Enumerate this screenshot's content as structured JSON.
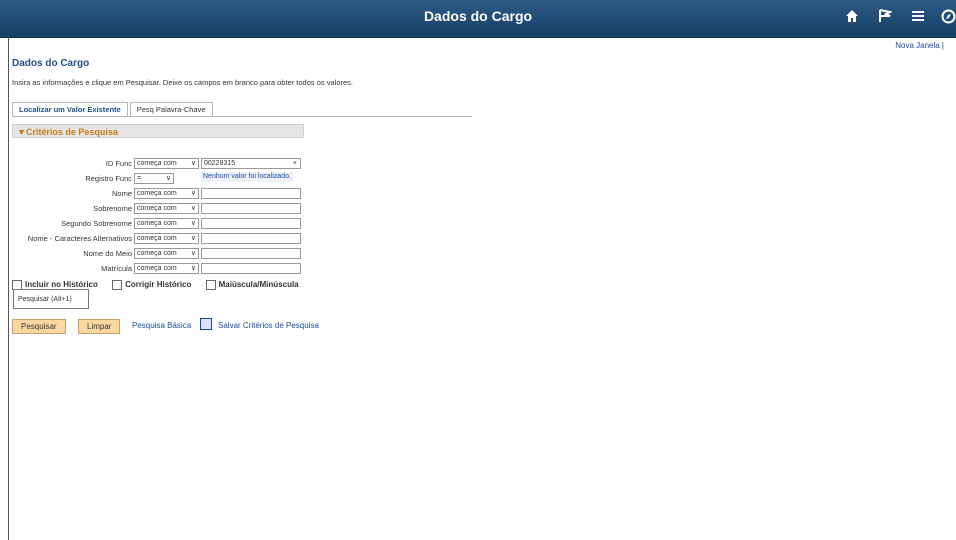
{
  "header": {
    "title": "Dados do Cargo"
  },
  "top_links": {
    "nova_janela": "Nova Janela |"
  },
  "page": {
    "title": "Dados do Cargo",
    "instruction": "Insira as informações e clique em Pesquisar. Deixe os campos em branco para obter todos os valores."
  },
  "tabs": [
    {
      "label": "Localizar um Valor Existente",
      "active": true
    },
    {
      "label": "Pesq Palavra-Chave",
      "active": false
    }
  ],
  "criteria": {
    "title": "▼Critérios de Pesquisa",
    "hint": "Nenhum valor foi localizado.",
    "rows": [
      {
        "label": "ID Func",
        "operator": "começa com",
        "value": "00228315",
        "has_clear": true
      },
      {
        "label": "Registro Func",
        "operator": "=",
        "value": "",
        "has_input": false
      },
      {
        "label": "Nome",
        "operator": "começa com",
        "value": ""
      },
      {
        "label": "Sobrenome",
        "operator": "começa com",
        "value": ""
      },
      {
        "label": "Segundo Sobrenome",
        "operator": "começa com",
        "value": ""
      },
      {
        "label": "Nome - Caracteres Alternativos",
        "operator": "começa com",
        "value": ""
      },
      {
        "label": "Nome do Meio",
        "operator": "começa com",
        "value": ""
      },
      {
        "label": "Matrícula",
        "operator": "começa com",
        "value": ""
      }
    ]
  },
  "checkboxes": {
    "incluir_historico": "Incluir no Histórico",
    "corrigir_historico": "Corrigir Histórico",
    "maiuscula": "Maiúscula/Minúscula"
  },
  "tooltip": "Pesquisar (Alt+1)",
  "actions": {
    "search": "Pesquisar",
    "clear": "Limpar",
    "basic_search": "Pesquisa Básica",
    "save_criteria": "Salvar Critérios de Pesquisa"
  },
  "icons": {
    "home": "home-icon",
    "flag": "flag-icon",
    "menu": "hamburger-icon",
    "navbar": "compass-icon"
  }
}
